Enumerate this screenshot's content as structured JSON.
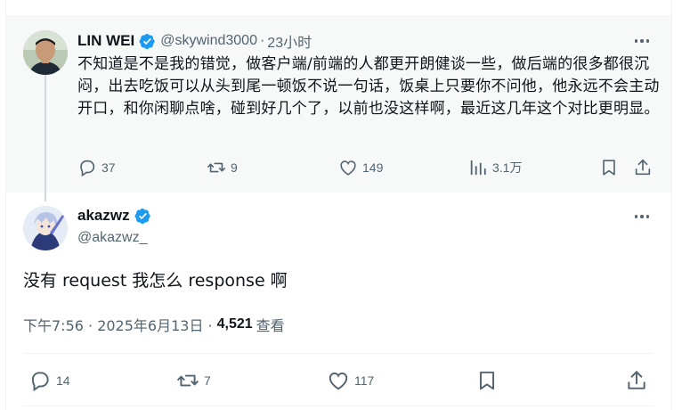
{
  "parent_tweet": {
    "author": {
      "display_name": "LIN WEI",
      "handle": "@skywind3000",
      "verified": true,
      "avatar_icon": "person-photo-avatar"
    },
    "time_sep": "·",
    "time": "23小时",
    "text": "不知道是不是我的错觉，做客户端/前端的人都更开朗健谈一些，做后端的很多都很沉闷，出去吃饭可以从头到尾一顿饭不说一句话，饭桌上只要你不问他，他永远不会主动开口，和你闲聊点啥，碰到好几个了，以前也没这样啊，最近这几年这个对比更明显。",
    "actions": {
      "replies": "37",
      "retweets": "9",
      "likes": "149",
      "views": "3.1万"
    }
  },
  "reply_tweet": {
    "author": {
      "display_name": "akazwz",
      "handle": "@akazwz_",
      "verified": true,
      "avatar_icon": "anime-character-avatar"
    },
    "text": "没有 request 我怎么 response 啊",
    "timestamp": "下午7:56 · 2025年6月13日 · ",
    "views_count": "4,521",
    "views_label": "查看",
    "actions": {
      "replies": "14",
      "retweets": "7",
      "likes": "117"
    }
  },
  "colors": {
    "text_primary": "#0f1419",
    "text_secondary": "#536471",
    "verified_blue": "#1d9bf0",
    "parent_bg": "#f7f9f9",
    "thread_line": "#cfd9de"
  }
}
